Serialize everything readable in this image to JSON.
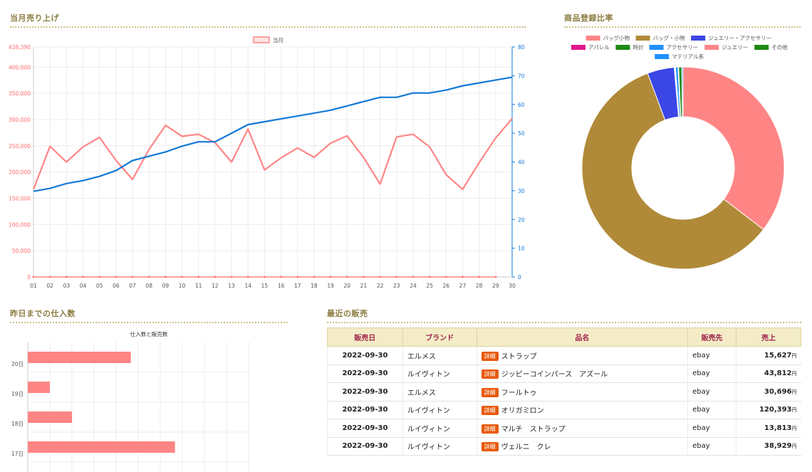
{
  "sections": {
    "monthly_sales": "当月売り上げ",
    "product_ratio": "商品登録比率",
    "purchases": "昨日までの仕入数",
    "recent_sales": "最近の販売"
  },
  "chart_data": [
    {
      "type": "line",
      "legend": [
        "当月"
      ],
      "x": [
        "01",
        "02",
        "03",
        "04",
        "05",
        "06",
        "07",
        "08",
        "09",
        "10",
        "11",
        "12",
        "13",
        "14",
        "15",
        "16",
        "17",
        "18",
        "19",
        "20",
        "21",
        "22",
        "23",
        "24",
        "25",
        "26",
        "27",
        "28",
        "29",
        "30"
      ],
      "y_left_ticks": [
        "0",
        "50,000",
        "100,000",
        "150,000",
        "200,000",
        "250,000",
        "300,000",
        "350,000",
        "400,000",
        "438,390"
      ],
      "y_left_values": [
        0,
        50000,
        100000,
        150000,
        200000,
        250000,
        300000,
        350000,
        400000,
        438390
      ],
      "y_right_ticks": [
        0,
        10,
        20,
        30,
        40,
        50,
        60,
        70,
        80
      ],
      "ylim_left": [
        0,
        438390
      ],
      "ylim_right": [
        0,
        80
      ],
      "series": [
        {
          "name": "当月",
          "axis": "left",
          "color": "#ff8585",
          "values": [
            167000,
            249000,
            219000,
            248000,
            266000,
            222000,
            186000,
            243000,
            289000,
            268000,
            272000,
            256000,
            219000,
            282000,
            204000,
            227000,
            246000,
            228000,
            255000,
            269000,
            228000,
            177000,
            267000,
            272000,
            248000,
            195000,
            167000,
            218000,
            265000,
            302000
          ]
        },
        {
          "axis": "right",
          "color": "#1279d8",
          "values": [
            29.8,
            30.8,
            32.5,
            33.5,
            35,
            37,
            40.5,
            42,
            43.5,
            45.5,
            47,
            47,
            50,
            53,
            54,
            55,
            56,
            57,
            58,
            59.5,
            61,
            62.5,
            62.5,
            64,
            64,
            65,
            66.5,
            67.5,
            68.5,
            69.5
          ]
        },
        {
          "axis": "left",
          "color": "#ff8585",
          "values": [
            0,
            0,
            0,
            0,
            0,
            0,
            0,
            0,
            0,
            0,
            0,
            0,
            0,
            0,
            0,
            0,
            0,
            0,
            0,
            0,
            0,
            0,
            0,
            0,
            0,
            0,
            0,
            0,
            0
          ]
        }
      ],
      "grid": true
    },
    {
      "type": "pie",
      "legend": [
        {
          "label": "バッグ小物",
          "color": "#ff8585"
        },
        {
          "label": "バッグ・小物",
          "color": "#b08a38"
        },
        {
          "label": "ジュエリー・アクセサリー",
          "color": "#3b46e6"
        },
        {
          "label": "アパレル",
          "color": "#e0168a"
        },
        {
          "label": "時計",
          "color": "#1e8a14"
        },
        {
          "label": "アクセサリー",
          "color": "#1e90ff"
        },
        {
          "label": "ジュエリー",
          "color": "#ff8585"
        },
        {
          "label": "その他",
          "color": "#1e8a14"
        },
        {
          "label": "マテリアル系",
          "color": "#1e90ff"
        }
      ],
      "slices": [
        {
          "label": "バッグ小物",
          "value": 35.4,
          "color": "#ff8585"
        },
        {
          "label": "バッグ・小物",
          "value": 58.9,
          "color": "#b08a38"
        },
        {
          "label": "ジュエリー・アクセサリー",
          "value": 4.3,
          "color": "#3b46e6"
        },
        {
          "label": "アパレル",
          "value": 0.1,
          "color": "#e0168a"
        },
        {
          "label": "時計",
          "value": 0.1,
          "color": "#1e8a14"
        },
        {
          "label": "アクセサリー",
          "value": 0.4,
          "color": "#1e90ff"
        },
        {
          "label": "ジュエリー",
          "value": 0.1,
          "color": "#ff8585"
        },
        {
          "label": "その他",
          "value": 0.5,
          "color": "#1e8a14"
        },
        {
          "label": "マテリアル系",
          "value": 0.2,
          "color": "#1e90ff"
        }
      ]
    },
    {
      "type": "bar",
      "orientation": "horizontal",
      "title": "仕入数と販売数",
      "categories": [
        "20日",
        "19日",
        "18日",
        "17日"
      ],
      "values": [
        14,
        3,
        6,
        20
      ],
      "xlim": [
        0,
        30
      ],
      "color": "#ff8585"
    }
  ],
  "sales_table": {
    "headers": [
      "販売日",
      "ブランド",
      "品名",
      "販売先",
      "売上"
    ],
    "badge": "詳細",
    "unit": "円",
    "rows": [
      {
        "date": "2022-09-30",
        "brand": "エルメス",
        "item": "ストラップ",
        "dest": "ebay",
        "amount": "15,627"
      },
      {
        "date": "2022-09-30",
        "brand": "ルイヴィトン",
        "item": "ジッピーコインパース　アズール",
        "dest": "ebay",
        "amount": "43,812"
      },
      {
        "date": "2022-09-30",
        "brand": "エルメス",
        "item": "フールトゥ",
        "dest": "ebay",
        "amount": "30,696"
      },
      {
        "date": "2022-09-30",
        "brand": "ルイヴィトン",
        "item": "オリガミロン",
        "dest": "ebay",
        "amount": "120,393"
      },
      {
        "date": "2022-09-30",
        "brand": "ルイヴィトン",
        "item": "マルチ　ストラップ",
        "dest": "ebay",
        "amount": "13,813"
      },
      {
        "date": "2022-09-30",
        "brand": "ルイヴィトン",
        "item": "ヴェルニ　クレ",
        "dest": "ebay",
        "amount": "38,929"
      }
    ]
  }
}
